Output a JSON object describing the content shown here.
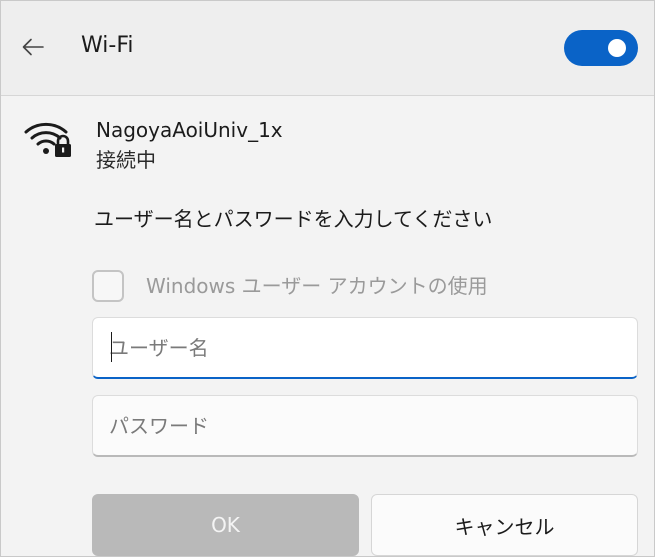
{
  "header": {
    "title": "Wi-Fi",
    "back_icon": "back-arrow-icon",
    "wifi_toggle_on": true,
    "accent_color": "#0a63c7"
  },
  "network": {
    "icon": "wifi-secured-icon",
    "name": "NagoyaAoiUniv_1x",
    "status": "接続中"
  },
  "login": {
    "prompt": "ユーザー名とパスワードを入力してください",
    "use_windows_account_label": "Windows ユーザー アカウントの使用",
    "use_windows_account_checked": false,
    "username_value": "",
    "username_placeholder": "ユーザー名",
    "password_value": "",
    "password_placeholder": "パスワード"
  },
  "buttons": {
    "ok_label": "OK",
    "cancel_label": "キャンセル"
  }
}
